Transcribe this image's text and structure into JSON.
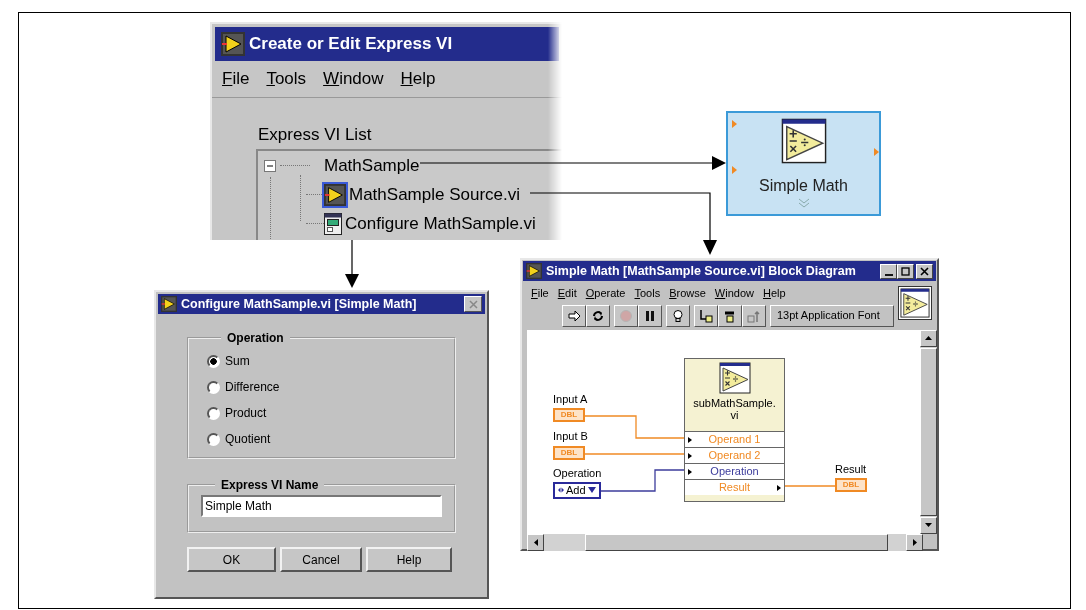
{
  "express_vi_window": {
    "title": "Create or Edit Express VI",
    "menu": [
      "File",
      "Tools",
      "Window",
      "Help"
    ],
    "list_label": "Express VI List",
    "tree": [
      {
        "label": "MathSample",
        "expanded": true,
        "children": [
          {
            "label": "MathSample Source.vi",
            "kind": "source",
            "selected": true
          },
          {
            "label": "Configure MathSample.vi",
            "kind": "config",
            "selected": false
          }
        ]
      }
    ]
  },
  "express_node": {
    "label": "Simple Math"
  },
  "config_dialog": {
    "title": "Configure MathSample.vi [Simple Math]",
    "operation_label": "Operation",
    "operations": [
      {
        "label": "Sum",
        "selected": true
      },
      {
        "label": "Difference",
        "selected": false
      },
      {
        "label": "Product",
        "selected": false
      },
      {
        "label": "Quotient",
        "selected": false
      }
    ],
    "name_label": "Express VI Name",
    "name_value": "Simple Math",
    "buttons": [
      "OK",
      "Cancel",
      "Help"
    ]
  },
  "block_diagram": {
    "title": "Simple Math [MathSample Source.vi] Block Diagram",
    "menu": [
      "File",
      "Edit",
      "Operate",
      "Tools",
      "Browse",
      "Window",
      "Help"
    ],
    "toolbar": [
      {
        "kind": "run",
        "disabled": false
      },
      {
        "kind": "run_continuous",
        "disabled": false
      },
      {
        "kind": "abort",
        "disabled": true
      },
      {
        "kind": "pause",
        "disabled": false
      },
      {
        "kind": "highlight",
        "disabled": false
      },
      {
        "kind": "step_into",
        "disabled": false
      },
      {
        "kind": "step_over",
        "disabled": false
      },
      {
        "kind": "step_out",
        "disabled": true
      }
    ],
    "font_select": "13pt Application Font",
    "controls": [
      {
        "label": "Input A",
        "kind": "numeric",
        "text": "DBL"
      },
      {
        "label": "Input B",
        "kind": "numeric",
        "text": "DBL"
      },
      {
        "label": "Operation",
        "kind": "enum",
        "text": "Add"
      }
    ],
    "subvi": {
      "label": "subMathSample.vi",
      "terminals": [
        {
          "label": "Operand 1",
          "kind": "input",
          "color": "#f08a24"
        },
        {
          "label": "Operand 2",
          "kind": "input",
          "color": "#f08a24"
        },
        {
          "label": "Operation",
          "kind": "input",
          "color": "#3c3c9c"
        },
        {
          "label": "Result",
          "kind": "output",
          "color": "#f08a24"
        }
      ]
    },
    "indicator": {
      "label": "Result",
      "text": "DBL"
    }
  }
}
